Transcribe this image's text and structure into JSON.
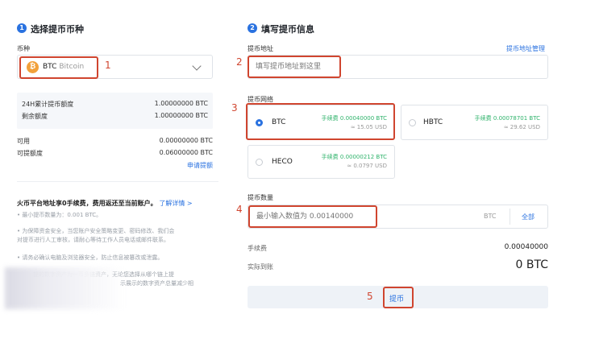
{
  "left": {
    "step_num": "1",
    "title": "选择提币币种",
    "currency_label": "币种",
    "coin_symbol_glyph": "₿",
    "coin_code": "BTC",
    "coin_name": "Bitcoin",
    "anno1": "1",
    "limits": [
      {
        "label": "24H累计提币额度",
        "value": "1.00000000 BTC"
      },
      {
        "label": "剩余额度",
        "value": "1.00000000 BTC"
      }
    ],
    "balances": [
      {
        "label": "可用",
        "value": "0.00000000 BTC"
      },
      {
        "label": "可提额度",
        "value": "0.06000000 BTC"
      }
    ],
    "apply_link": "申请提额",
    "notice_title": "火币平台地址享0手续费，费用返还至当前账户。",
    "notice_link": "了解详情 >",
    "notes": [
      "最小提币数量为：0.001 BTC。",
      "为保障资金安全，当您账户安全策略变更、密码修改、我们会",
      "对提币进行人工审核，请耐心等待工作人员电话或邮件联系。",
      "请务必确认电脑及浏览器安全，防止信息被篡改或泄露。",
      "提的数字资产为一币多链资产，无论您选择从哪个链上提",
      "示展示的数字资产总量减少相"
    ]
  },
  "right": {
    "step_num": "2",
    "title": "填写提币信息",
    "address_label": "提币地址",
    "address_manage": "提币地址管理",
    "address_placeholder": "填写提币地址到这里",
    "anno2": "2",
    "network_label": "提币网络",
    "anno3": "3",
    "networks": [
      {
        "name": "BTC",
        "fee": "手续费 0.00040000 BTC",
        "approx": "≈ 15.05 USD",
        "selected": true
      },
      {
        "name": "HBTC",
        "fee": "手续费 0.00078701 BTC",
        "approx": "≈ 29.62 USD",
        "selected": false
      },
      {
        "name": "HECO",
        "fee": "手续费 0.00000212 BTC",
        "approx": "≈ 0.0797 USD",
        "selected": false
      }
    ],
    "amount_label": "提币数量",
    "anno4": "4",
    "amount_placeholder": "最小输入数值为 0.00140000",
    "amount_unit": "BTC",
    "amount_all": "全部",
    "fee_label": "手续费",
    "fee_value": "0.00040000",
    "actual_label": "实际到账",
    "actual_value": "0 BTC",
    "anno5": "5",
    "submit": "提币"
  },
  "colors": {
    "accent": "#2a72e0",
    "annotation": "#d0452f",
    "fee_green": "#2fb36b"
  }
}
